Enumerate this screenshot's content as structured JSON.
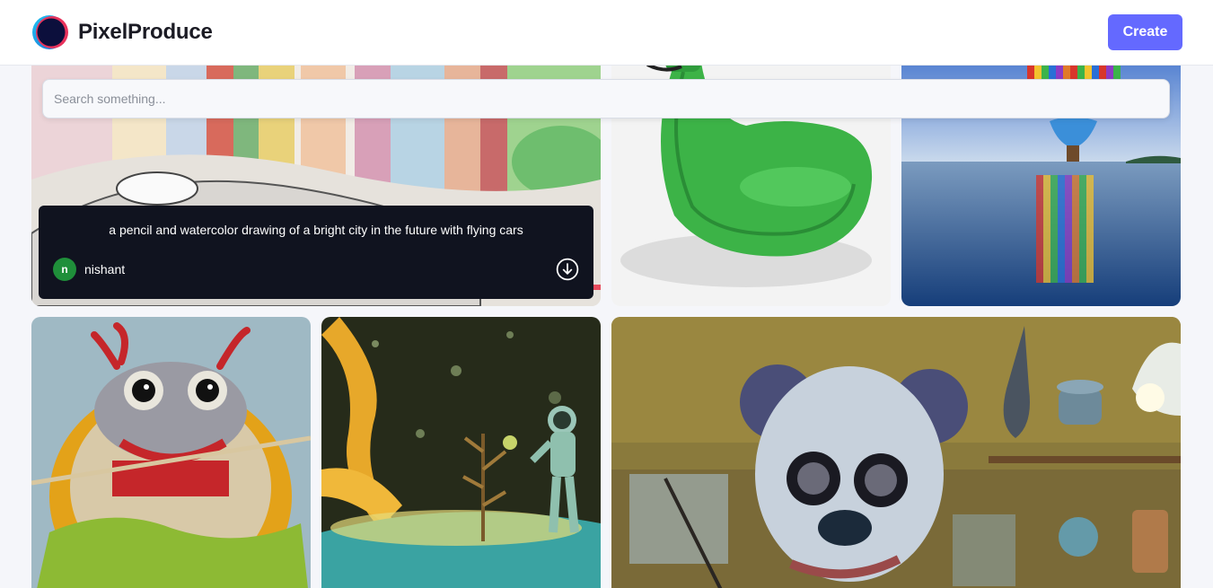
{
  "header": {
    "brand": "PixelProduce",
    "create_label": "Create"
  },
  "search": {
    "placeholder": "Search something..."
  },
  "gallery": {
    "cards": [
      {
        "image": "pencil-watercolor-city",
        "prompt": "a pencil and watercolor drawing of a bright city in the future with flying cars",
        "author": "nishant",
        "avatar_initial": "n"
      },
      {
        "image": "green-egg-chair"
      },
      {
        "image": "hot-air-balloon-over-sea"
      },
      {
        "image": "knitted-crab-bowl"
      },
      {
        "image": "astronaut-plant-diorama"
      },
      {
        "image": "panda-scientist-glasses"
      }
    ]
  },
  "icons": {
    "download": "download-icon",
    "logo": "pixelproduce-logo-icon"
  },
  "colors": {
    "accent": "#6469ff",
    "overlay": "#10131f",
    "avatar": "#1f8f3a"
  }
}
